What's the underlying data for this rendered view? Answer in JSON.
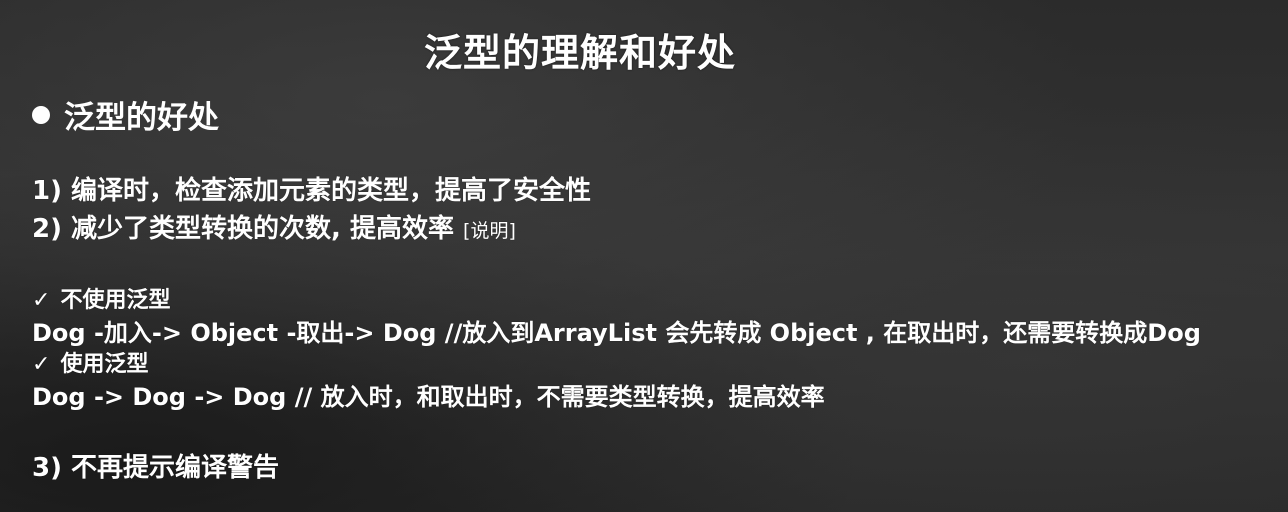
{
  "slide": {
    "title": "泛型的理解和好处",
    "heading": "泛型的好处",
    "points": [
      {
        "text": "1) 编译时，检查添加元素的类型，提高了安全性"
      },
      {
        "text": "2) 减少了类型转换的次数, 提高效率",
        "note": "[说明]"
      },
      {
        "text": "3) 不再提示编译警告"
      }
    ],
    "comparisons": [
      {
        "check": "✓",
        "label": "不使用泛型",
        "flow": "Dog -加入-> Object -取出-> Dog //放入到ArrayList 会先转成 Object , 在取出时，还需要转换成Dog"
      },
      {
        "check": "✓",
        "label": "使用泛型",
        "flow": "Dog -> Dog -> Dog // 放入时，和取出时，不需要类型转换，提高效率"
      }
    ]
  }
}
